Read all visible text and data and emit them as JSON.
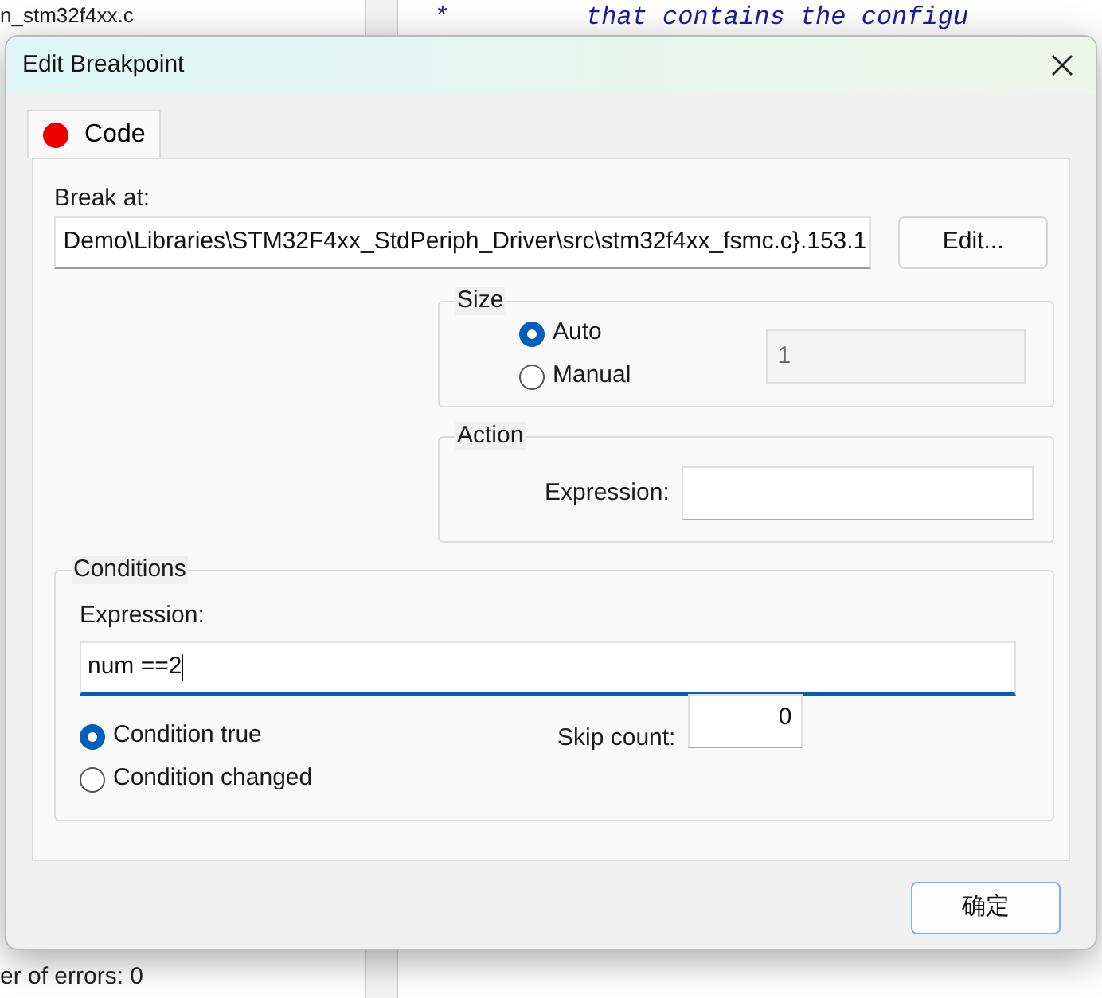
{
  "background": {
    "file_tab": "n_stm32f4xx.c",
    "code_line": "*         that contains the configu",
    "output_line": "er of errors: 0"
  },
  "window": {
    "title": "Edit Breakpoint"
  },
  "tabs": [
    {
      "label": "Code",
      "selected": true,
      "color": "#ee0000"
    }
  ],
  "break_at": {
    "label": "Break at:",
    "value": "Demo\\Libraries\\STM32F4xx_StdPeriph_Driver\\src\\stm32f4xx_fsmc.c}.153.1",
    "button": "Edit..."
  },
  "size": {
    "legend": "Size",
    "options": [
      {
        "label": "Auto",
        "selected": true
      },
      {
        "label": "Manual",
        "selected": false
      }
    ],
    "value": "1",
    "disabled": true
  },
  "action": {
    "legend": "Action",
    "label": "Expression:"
  },
  "conditions": {
    "legend": "Conditions",
    "label": "Expression:",
    "value": "num ==2",
    "options": [
      {
        "label": "Condition true",
        "selected": true
      },
      {
        "label": "Condition changed",
        "selected": false
      }
    ],
    "skip_label": "Skip count:",
    "skip_value": "0"
  },
  "buttons": [
    "确定"
  ]
}
